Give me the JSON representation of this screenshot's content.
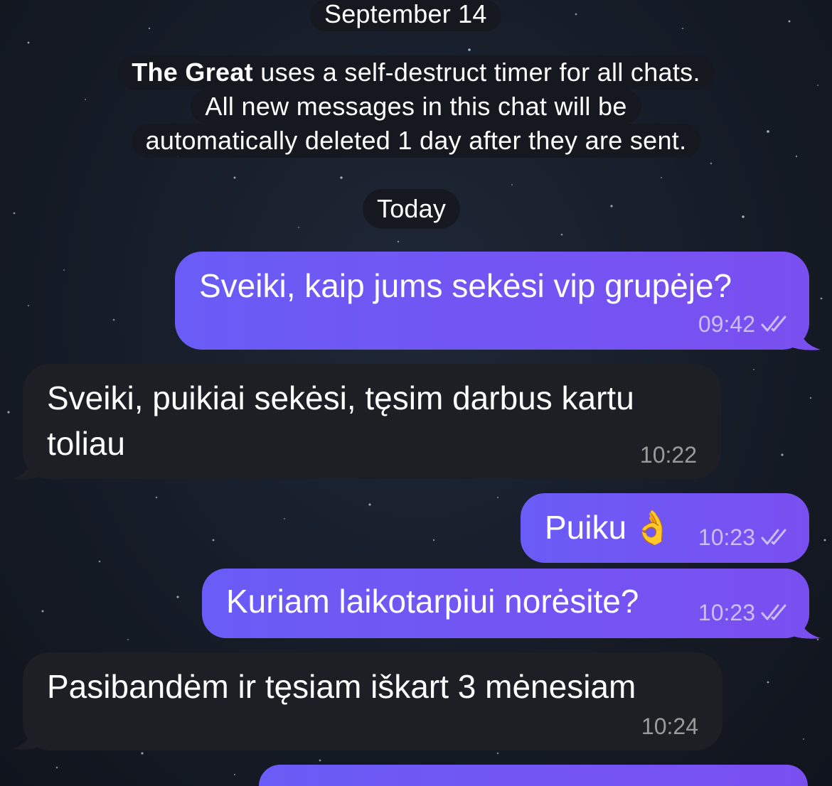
{
  "date_headers": {
    "september": "September 14",
    "today": "Today"
  },
  "notice": {
    "bold": "The Great",
    "line1_rest": " uses a self-destruct timer for all chats.",
    "line2": "All new messages in this chat will be",
    "line3": "automatically deleted 1 day after they are sent."
  },
  "messages": [
    {
      "direction": "outgoing",
      "text": "Sveiki, kaip jums sekėsi vip grupėje?",
      "time": "09:42",
      "status": "read"
    },
    {
      "direction": "incoming",
      "text_line1": "Sveiki, puikiai sekėsi, tęsim darbus kartu",
      "text_line2": "toliau",
      "time": "10:22"
    },
    {
      "direction": "outgoing",
      "text": "Puiku",
      "emoji": "👌",
      "time": "10:23",
      "status": "read"
    },
    {
      "direction": "outgoing",
      "text": "Kuriam laikotarpiui norėsite?",
      "time": "10:23",
      "status": "read"
    },
    {
      "direction": "incoming",
      "text": "Pasibandėm ir tęsiam iškart 3 mėnesiam",
      "time": "10:24"
    },
    {
      "direction": "outgoing",
      "text": "",
      "partial": true
    }
  ],
  "colors": {
    "outgoing_bubble": "#6f57f3",
    "incoming_bubble": "#1e1f24",
    "background": "#161c27"
  }
}
